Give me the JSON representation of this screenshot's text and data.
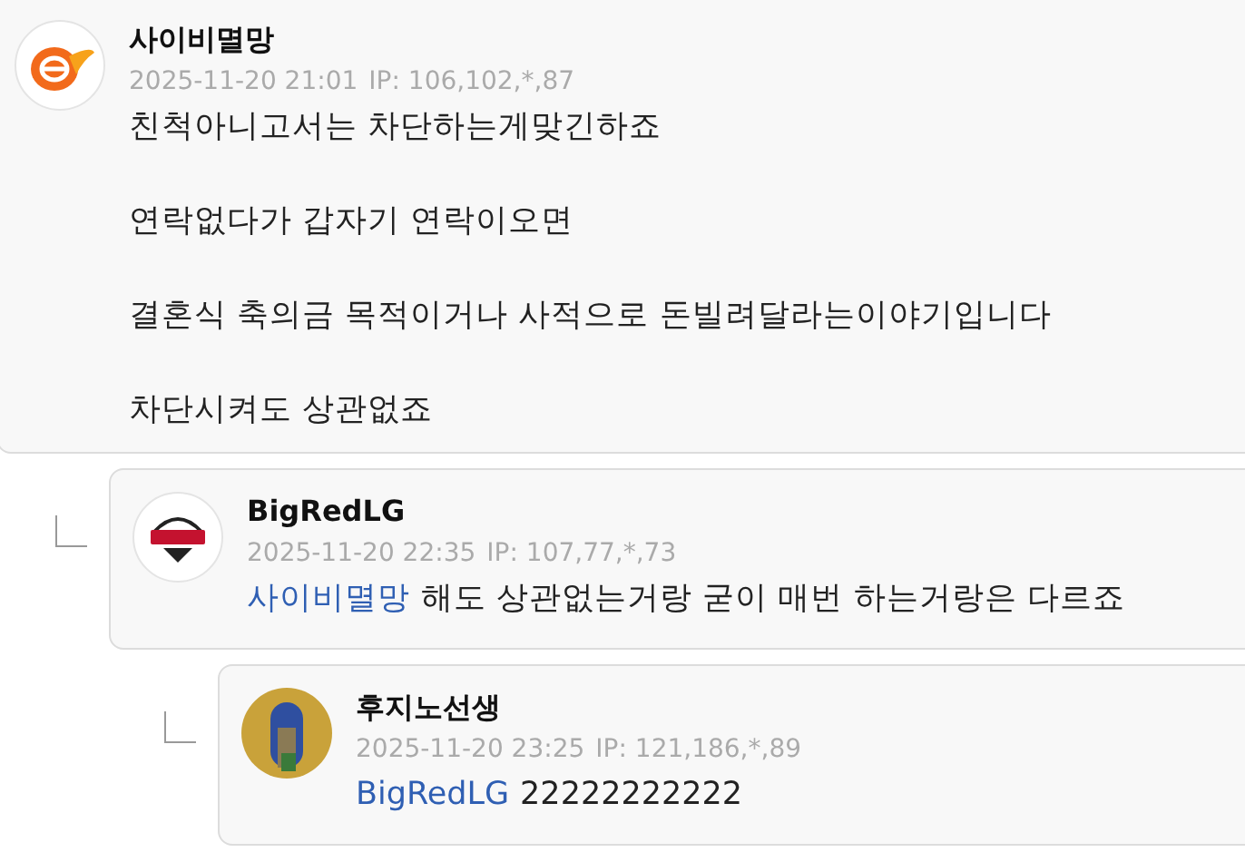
{
  "comments": [
    {
      "author": "사이비멸망",
      "avatar": {
        "kind": "orange-logo"
      },
      "date": "2025-11-20 21:01",
      "ip": "IP: 106,102,*,87",
      "paragraphs": [
        "친척아니고서는 차단하는게맞긴하죠",
        "연락없다가 갑자기 연락이오면",
        "결혼식 축의금 목적이거나 사적으로 돈빌려달라는이야기입니다",
        "차단시켜도 상관없죠"
      ],
      "children": [
        {
          "author": "BigRedLG",
          "avatar": {
            "kind": "team-logo"
          },
          "date": "2025-11-20 22:35",
          "ip": "IP: 107,77,*,73",
          "mention": "사이비멸망",
          "paragraphs": [
            "해도 상관없는거랑 굳이 매번 하는거랑은 다르죠"
          ],
          "children": [
            {
              "author": "후지노선생",
              "avatar": {
                "kind": "photo"
              },
              "date": "2025-11-20 23:25",
              "ip": "IP: 121,186,*,89",
              "mention": "BigRedLG",
              "paragraphs": [
                "22222222222"
              ]
            }
          ]
        }
      ]
    }
  ]
}
